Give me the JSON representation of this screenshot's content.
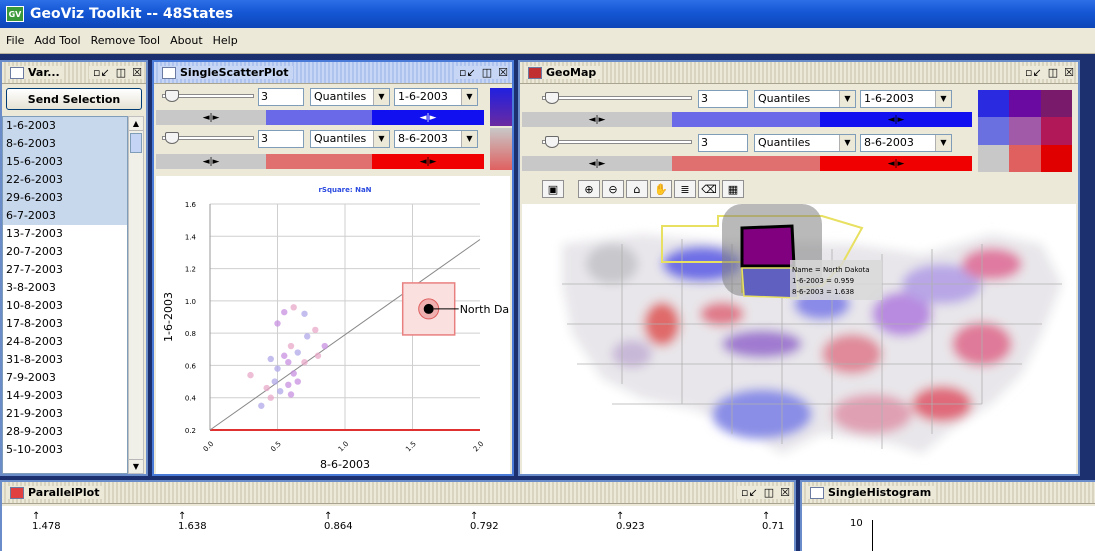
{
  "app": {
    "title": "GeoViz Toolkit -- 48States",
    "icon_label": "GV"
  },
  "menu": [
    "File",
    "Add Tool",
    "Remove Tool",
    "About",
    "Help"
  ],
  "varwin": {
    "title": "Var...",
    "button": "Send Selection",
    "items": [
      "1-6-2003",
      "8-6-2003",
      "15-6-2003",
      "22-6-2003",
      "29-6-2003",
      "6-7-2003",
      "13-7-2003",
      "20-7-2003",
      "27-7-2003",
      "3-8-2003",
      "10-8-2003",
      "17-8-2003",
      "24-8-2003",
      "31-8-2003",
      "7-9-2003",
      "14-9-2003",
      "21-9-2003",
      "28-9-2003",
      "5-10-2003"
    ],
    "selected_count": 6
  },
  "window_controls": {
    "minimize": "▫↙",
    "maximize": "◫",
    "close": "☒"
  },
  "scatter": {
    "title": "SingleScatterPlot",
    "x_controls": {
      "classes": "3",
      "method": "Quantiles",
      "variable": "1-6-2003"
    },
    "y_controls": {
      "classes": "3",
      "method": "Quantiles",
      "variable": "8-6-2003"
    },
    "divider": "◄|►",
    "rsquare": "rSquare: NaN",
    "ylabel": "1-6-2003",
    "xlabel": "8-6-2003",
    "yticks": [
      "1.6",
      "1.4",
      "1.2",
      "1.0",
      "0.8",
      "0.6",
      "0.4",
      "0.2"
    ],
    "xticks": [
      "0.0",
      "0.5",
      "1.0",
      "1.5",
      "2.0"
    ],
    "highlight_label": "North Da"
  },
  "chart_data": {
    "type": "scatter",
    "title": "rSquare: NaN",
    "xlabel": "8-6-2003",
    "ylabel": "1-6-2003",
    "xlim": [
      0,
      2.0
    ],
    "ylim": [
      0.2,
      1.6
    ],
    "points": [
      [
        0.55,
        0.93
      ],
      [
        0.62,
        0.96
      ],
      [
        0.7,
        0.92
      ],
      [
        0.5,
        0.86
      ],
      [
        0.78,
        0.82
      ],
      [
        0.72,
        0.78
      ],
      [
        0.85,
        0.72
      ],
      [
        0.6,
        0.72
      ],
      [
        0.65,
        0.68
      ],
      [
        0.55,
        0.66
      ],
      [
        0.8,
        0.66
      ],
      [
        0.45,
        0.64
      ],
      [
        0.58,
        0.62
      ],
      [
        0.7,
        0.62
      ],
      [
        0.5,
        0.58
      ],
      [
        0.62,
        0.55
      ],
      [
        0.3,
        0.54
      ],
      [
        0.48,
        0.5
      ],
      [
        0.58,
        0.48
      ],
      [
        0.42,
        0.46
      ],
      [
        0.52,
        0.44
      ],
      [
        0.6,
        0.42
      ],
      [
        0.45,
        0.4
      ],
      [
        0.38,
        0.35
      ],
      [
        0.65,
        0.5
      ],
      [
        1.62,
        0.95
      ]
    ],
    "highlight": {
      "x": 1.62,
      "y": 0.95,
      "label": "North Da"
    },
    "trend_line": [
      [
        0,
        0.2
      ],
      [
        2.0,
        1.38
      ]
    ]
  },
  "geomap": {
    "title": "GeoMap",
    "x_controls": {
      "classes": "3",
      "method": "Quantiles",
      "variable": "1-6-2003"
    },
    "y_controls": {
      "classes": "3",
      "method": "Quantiles",
      "variable": "8-6-2003"
    },
    "tooltip": {
      "name": "Name = North Dakota",
      "v1": "1-6-2003 = 0.959",
      "v2": "8-6-2003 = 1.638"
    },
    "legend_colors": [
      "#2a2ae0",
      "#6a0aa0",
      "#7a1a6a",
      "#6a70e0",
      "#a05aa8",
      "#b01858",
      "#c8c8c8",
      "#e06060",
      "#e00000"
    ]
  },
  "parallel": {
    "title": "ParallelPlot",
    "values": [
      "1.478",
      "1.638",
      "0.864",
      "0.792",
      "0.923",
      "0.71"
    ]
  },
  "histogram": {
    "title": "SingleHistogram",
    "tick": "10"
  }
}
